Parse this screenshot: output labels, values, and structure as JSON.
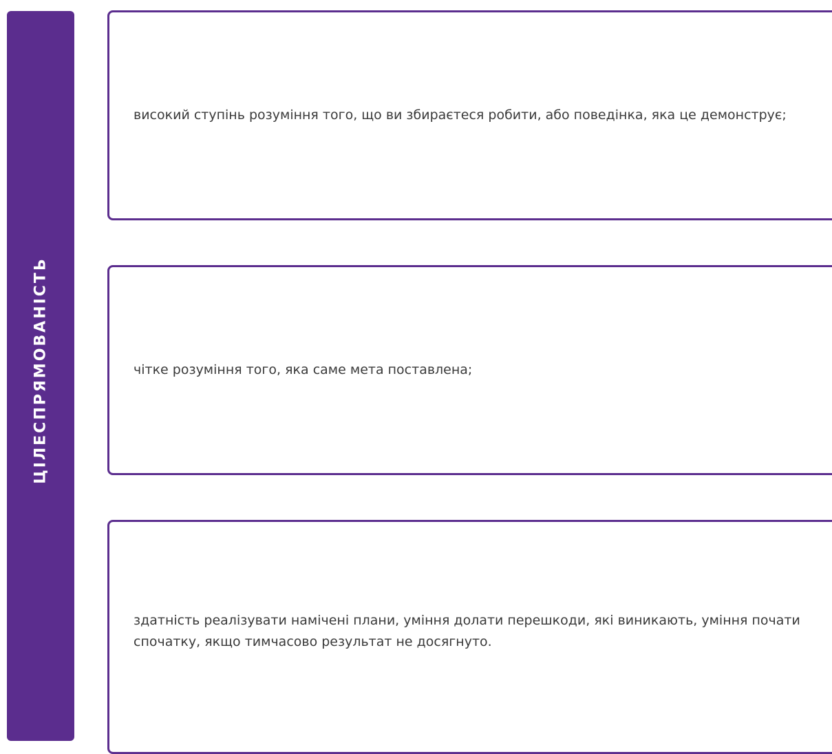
{
  "sidebar": {
    "title": "ЦІЛЕСПРЯМОВАНІСТЬ"
  },
  "cards": [
    {
      "text": "високий ступінь розуміння того, що ви збираєтеся робити, або поведінка, яка це демонструє;"
    },
    {
      "text": "чітке розуміння того, яка саме мета поставлена;"
    },
    {
      "text": "здатність реалізувати намічені плани, уміння долати перешкоди, які виникають, уміння почати спочатку, якщо тимчасово результат не досягнуто."
    }
  ],
  "colors": {
    "accent": "#5b2d8e",
    "text": "#3a3a3a"
  }
}
